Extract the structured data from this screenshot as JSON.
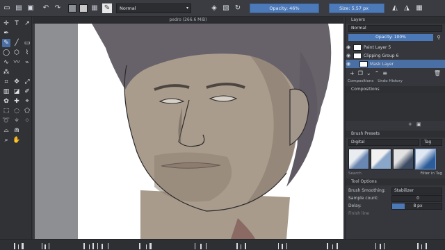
{
  "toolbar": {
    "blend_mode": "Normal",
    "opacity_label": "Opacity: 46%",
    "size_label": "Size: 5.57 px"
  },
  "canvas": {
    "document_title": "pedro (266.6 MiB)"
  },
  "layers_panel": {
    "title": "Layers",
    "blend_mode": "Normal",
    "opacity_label": "Opacity: 100%",
    "layers": [
      {
        "name": "Paint Layer 5"
      },
      {
        "name": "Clipping Group 6"
      },
      {
        "name": "Mask Layer"
      }
    ]
  },
  "docker_tabs": [
    "Compositions",
    "Undo History"
  ],
  "compositions_panel": {
    "title": "Compositions"
  },
  "brush_presets": {
    "title": "Brush Presets",
    "tag_label": "Digital",
    "tag_button": "Tag",
    "search_placeholder": "Search",
    "filter_label": "Filter in Tag"
  },
  "tool_options": {
    "title": "Tool Options",
    "brush_smoothing_label": "Brush Smoothing:",
    "brush_smoothing_value": "Stabilizer",
    "sample_count_label": "Sample count:",
    "sample_count_value": "0",
    "delay_label": "Delay:",
    "delay_value": "8 px",
    "finish_line_label": "Finish line"
  },
  "colors": {
    "accent": "#4b78b6",
    "panel_bg": "#35373c",
    "toolbar_bg": "#3a3c41",
    "foreground_swatch": "#8c8f95",
    "background_swatch": "#c9c9c9"
  }
}
